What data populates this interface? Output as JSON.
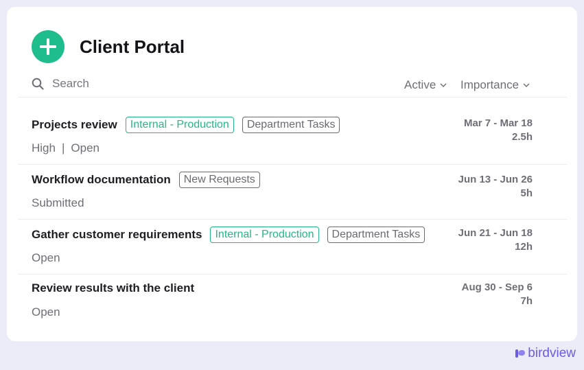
{
  "header": {
    "title": "Client Portal"
  },
  "toolbar": {
    "search_placeholder": "Search",
    "filter_status": "Active",
    "filter_importance": "Importance"
  },
  "rows": [
    {
      "name": "Projects review",
      "tags": [
        "Internal - Production",
        "Department Tasks"
      ],
      "priority": "High",
      "status": "Open",
      "dates": "Mar 7 - Mar 18",
      "hours": "2.5h"
    },
    {
      "name": "Workflow documentation",
      "tags": [
        "New Requests"
      ],
      "status": "Submitted",
      "dates": "Jun 13 - Jun 26",
      "hours": "5h"
    },
    {
      "name": "Gather customer requirements",
      "tags": [
        "Internal - Production",
        "Department Tasks"
      ],
      "status": "Open",
      "dates": "Jun 21 - Jun 18",
      "hours": "12h"
    },
    {
      "name": "Review results with the client",
      "tags": [],
      "status": "Open",
      "dates": "Aug 30 - Sep 6",
      "hours": "7h"
    }
  ],
  "brand": {
    "name": "birdview"
  },
  "colors": {
    "accent": "#20bd8c",
    "brand": "#6c5ce0",
    "background": "#ececf8"
  },
  "icons": [
    "plus-icon",
    "search-icon",
    "chevron-down-icon",
    "birdview-logo-icon"
  ]
}
